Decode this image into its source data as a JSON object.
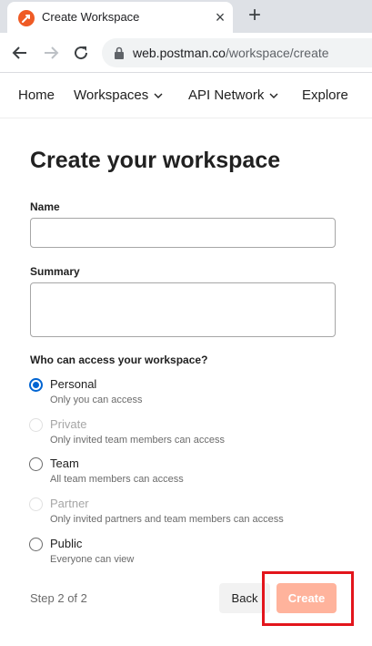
{
  "browser": {
    "tab_title": "Create Workspace",
    "tab_close_icon": "×",
    "new_tab_icon": "+",
    "url_host": "web.postman.co",
    "url_path": "/workspace/create",
    "favicon_color": "#ef5b25"
  },
  "nav": {
    "home": "Home",
    "workspaces": "Workspaces",
    "api_network": "API Network",
    "explore": "Explore"
  },
  "form": {
    "title": "Create your workspace",
    "name_label": "Name",
    "name_value": "",
    "summary_label": "Summary",
    "summary_value": "",
    "access_label": "Who can access your workspace?",
    "options": [
      {
        "title": "Personal",
        "desc": "Only you can access",
        "checked": true,
        "disabled": false
      },
      {
        "title": "Private",
        "desc": "Only invited team members can access",
        "checked": false,
        "disabled": true
      },
      {
        "title": "Team",
        "desc": "All team members can access",
        "checked": false,
        "disabled": false
      },
      {
        "title": "Partner",
        "desc": "Only invited partners and team members can access",
        "checked": false,
        "disabled": true
      },
      {
        "title": "Public",
        "desc": "Everyone can view",
        "checked": false,
        "disabled": false
      }
    ]
  },
  "footer": {
    "step": "Step 2 of 2",
    "back_label": "Back",
    "create_label": "Create"
  },
  "colors": {
    "accent": "#0265d2",
    "create_disabled": "#ffb39c",
    "highlight": "#e3151c"
  }
}
